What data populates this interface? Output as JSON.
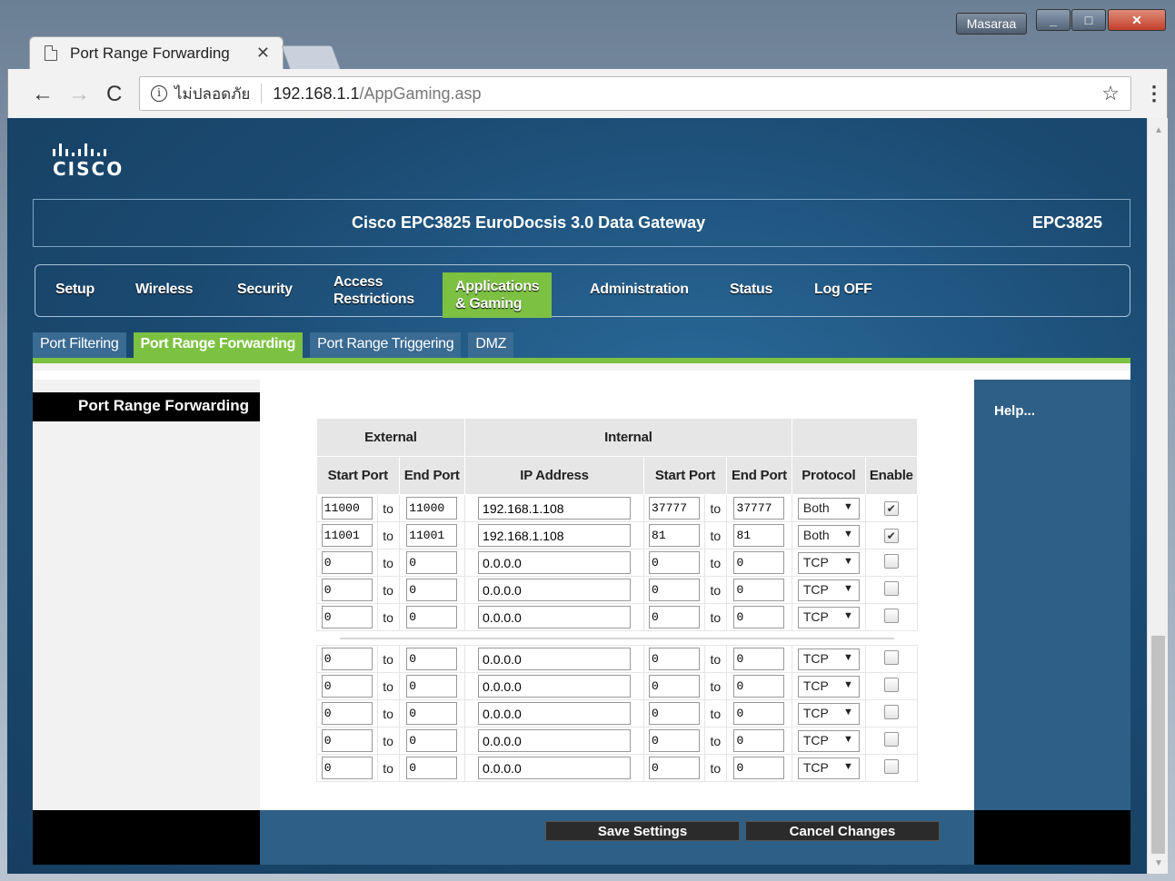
{
  "browser": {
    "tab_title": "Port Range Forwarding",
    "tab_close": "✕",
    "user_name": "Masaraa",
    "security_text": "ไม่ปลอดภัย",
    "url_host": "192.168.1.1",
    "url_path": "/AppGaming.asp"
  },
  "header": {
    "logo_text": "CISCO",
    "product_name": "Cisco EPC3825 EuroDocsis 3.0 Data Gateway",
    "model": "EPC3825"
  },
  "main_nav": {
    "setup": "Setup",
    "wireless": "Wireless",
    "security": "Security",
    "access_line1": "Access",
    "access_line2": "Restrictions",
    "apps_line1": "Applications",
    "apps_line2": "& Gaming",
    "administration": "Administration",
    "status": "Status",
    "logoff": "Log OFF"
  },
  "sub_nav": {
    "port_filtering": "Port Filtering",
    "port_range_forwarding": "Port Range Forwarding",
    "port_range_triggering": "Port Range Triggering",
    "dmz": "DMZ"
  },
  "section_title": "Port Range Forwarding",
  "help_link": "Help...",
  "table": {
    "group_external": "External",
    "group_internal": "Internal",
    "col_start_port": "Start Port",
    "col_end_port": "End Port",
    "col_ip": "IP Address",
    "col_protocol": "Protocol",
    "col_enable": "Enable",
    "to_label": "to",
    "rows": [
      {
        "ext_start": "11000",
        "ext_end": "11000",
        "ip": "192.168.1.108",
        "int_start": "37777",
        "int_end": "37777",
        "protocol": "Both",
        "enabled": true
      },
      {
        "ext_start": "11001",
        "ext_end": "11001",
        "ip": "192.168.1.108",
        "int_start": "81",
        "int_end": "81",
        "protocol": "Both",
        "enabled": true
      },
      {
        "ext_start": "0",
        "ext_end": "0",
        "ip": "0.0.0.0",
        "int_start": "0",
        "int_end": "0",
        "protocol": "TCP",
        "enabled": false
      },
      {
        "ext_start": "0",
        "ext_end": "0",
        "ip": "0.0.0.0",
        "int_start": "0",
        "int_end": "0",
        "protocol": "TCP",
        "enabled": false
      },
      {
        "ext_start": "0",
        "ext_end": "0",
        "ip": "0.0.0.0",
        "int_start": "0",
        "int_end": "0",
        "protocol": "TCP",
        "enabled": false
      }
    ],
    "rows2": [
      {
        "ext_start": "0",
        "ext_end": "0",
        "ip": "0.0.0.0",
        "int_start": "0",
        "int_end": "0",
        "protocol": "TCP",
        "enabled": false
      },
      {
        "ext_start": "0",
        "ext_end": "0",
        "ip": "0.0.0.0",
        "int_start": "0",
        "int_end": "0",
        "protocol": "TCP",
        "enabled": false
      },
      {
        "ext_start": "0",
        "ext_end": "0",
        "ip": "0.0.0.0",
        "int_start": "0",
        "int_end": "0",
        "protocol": "TCP",
        "enabled": false
      },
      {
        "ext_start": "0",
        "ext_end": "0",
        "ip": "0.0.0.0",
        "int_start": "0",
        "int_end": "0",
        "protocol": "TCP",
        "enabled": false
      },
      {
        "ext_start": "0",
        "ext_end": "0",
        "ip": "0.0.0.0",
        "int_start": "0",
        "int_end": "0",
        "protocol": "TCP",
        "enabled": false
      }
    ]
  },
  "buttons": {
    "save": "Save Settings",
    "cancel": "Cancel Changes"
  },
  "colors": {
    "accent_green": "#7cc142",
    "nav_blue": "#2e5f86"
  }
}
